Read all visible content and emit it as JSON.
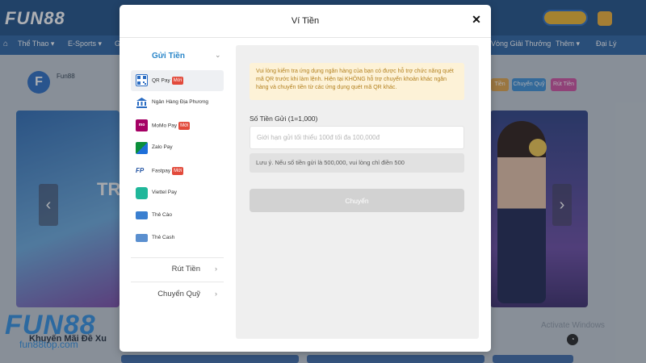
{
  "background": {
    "logo": "FUN88",
    "nav_items": [
      "Thể Thao ▾",
      "E-Sports ▾",
      "G",
      "Vòng Giải Thưởng",
      "Thêm ▾",
      "Đại Lý"
    ],
    "profile_name": "Fun88",
    "banner_text": "TR",
    "watermark_logo": "FUN88",
    "watermark_url": "fun88top.com",
    "promo_heading": "Khuyến Mãi Đề Xu",
    "right_watermark": "Activate Windows",
    "pills": [
      "Tiền",
      "Chuyển Quỹ",
      "Rút Tiền"
    ],
    "colors": {
      "header": "#1e4f86",
      "nav": "#2a63a2",
      "accent": "#2a86c9"
    }
  },
  "modal": {
    "title": "Ví Tiền",
    "close_icon": "close-icon",
    "sidebar": {
      "deposit_header": "Gửi Tiền",
      "methods": [
        {
          "label": "QR Pay",
          "badge": "Mới",
          "icon": "qr-code-icon",
          "active": true
        },
        {
          "label": "Ngân Hàng Địa Phương",
          "badge": "",
          "icon": "bank-icon",
          "active": false
        },
        {
          "label": "MoMo Pay",
          "badge": "Mới",
          "icon": "momo-icon",
          "active": false
        },
        {
          "label": "Zalo Pay",
          "badge": "",
          "icon": "zalopay-icon",
          "active": false
        },
        {
          "label": "Fastpay",
          "badge": "Mới",
          "icon": "fastpay-icon",
          "active": false
        },
        {
          "label": "Viettel Pay",
          "badge": "",
          "icon": "viettelpay-icon",
          "active": false
        },
        {
          "label": "Thẻ Cào",
          "badge": "",
          "icon": "scratch-card-icon",
          "active": false
        },
        {
          "label": "Thẻ Cash",
          "badge": "",
          "icon": "cash-card-icon",
          "active": false
        }
      ],
      "withdraw_label": "Rút Tiền",
      "transfer_label": "Chuyển Quỹ"
    },
    "content": {
      "notice": "Vui lòng kiểm tra ứng dụng ngân hàng của bạn có được hỗ trợ chức năng quét mã QR trước khi làm lệnh. Hiện tại KHÔNG hỗ trợ chuyển khoản khác ngân hàng và chuyển tiền từ các ứng dụng quét mã QR khác.",
      "amount_label": "Số Tiền Gửi (1=1,000)",
      "amount_placeholder": "Giới hạn gửi tối thiểu 100đ tối đa 100,000đ",
      "note": "Lưu ý. Nếu số tiền gửi là 500,000, vui lòng chỉ điền 500",
      "submit_label": "Chuyển"
    }
  }
}
